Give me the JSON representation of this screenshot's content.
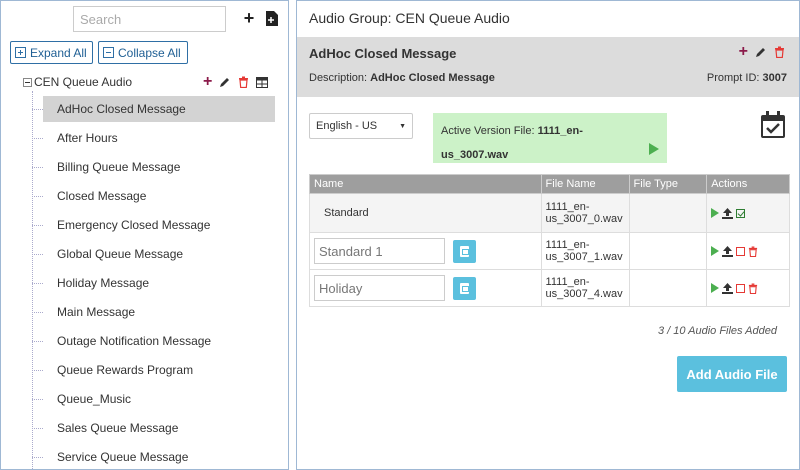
{
  "sidebar": {
    "search_placeholder": "Search",
    "expand_all_label": "Expand All",
    "collapse_all_label": "Collapse All",
    "root_label": "CEN Queue Audio",
    "items": [
      {
        "label": "AdHoc Closed Message",
        "selected": true
      },
      {
        "label": "After Hours"
      },
      {
        "label": "Billing Queue Message"
      },
      {
        "label": "Closed Message"
      },
      {
        "label": "Emergency Closed Message"
      },
      {
        "label": "Global Queue Message"
      },
      {
        "label": "Holiday Message"
      },
      {
        "label": "Main Message"
      },
      {
        "label": "Outage Notification Message"
      },
      {
        "label": "Queue Rewards Program"
      },
      {
        "label": "Queue_Music"
      },
      {
        "label": "Sales Queue Message"
      },
      {
        "label": "Service Queue Message"
      }
    ]
  },
  "main": {
    "title": "Audio Group: CEN Queue Audio",
    "message": {
      "name": "AdHoc Closed Message",
      "description_label": "Description:",
      "description_value": "AdHoc Closed Message",
      "prompt_label": "Prompt ID:",
      "prompt_value": "3007"
    },
    "language_selected": "English - US",
    "active_version_label": "Active Version File:",
    "active_version_file_1": "1111_en-",
    "active_version_file_2": "us_3007.wav",
    "table": {
      "headers": [
        "Name",
        "File Name",
        "File Type",
        "Actions"
      ],
      "rows": [
        {
          "name": "Standard",
          "file_1": "1111_en-",
          "file_2": "us_3007_0.wav",
          "type": ""
        },
        {
          "name": "Standard 1",
          "file_1": "1111_en-",
          "file_2": "us_3007_1.wav",
          "type": ""
        },
        {
          "name": "Holiday",
          "file_1": "1111_en-",
          "file_2": "us_3007_4.wav",
          "type": ""
        }
      ]
    },
    "files_count": "3 / 10 Audio Files Added",
    "add_button_label": "Add Audio File"
  },
  "colors": {
    "accent_blue": "#5bc0de",
    "active_green_bg": "#ccf2c8",
    "play_green": "#4caf50",
    "delete_red": "#e53935",
    "plus_purple": "#8b1a4a"
  }
}
